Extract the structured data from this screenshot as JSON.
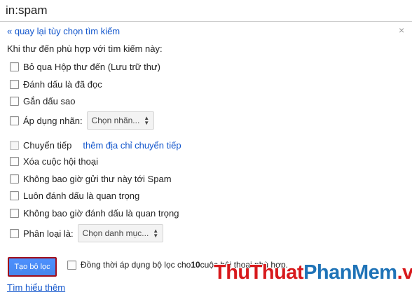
{
  "search": {
    "query": "in:spam"
  },
  "panel": {
    "back_link": "« quay lại tùy chọn tìm kiếm",
    "close": "×",
    "intro": "Khi thư đến phù hợp với tìm kiếm này:"
  },
  "options": {
    "skip_inbox": "Bỏ qua Hộp thư đến (Lưu trữ thư)",
    "mark_read": "Đánh dấu là đã đọc",
    "star": "Gắn dấu sao",
    "apply_label": "Áp dụng nhãn:",
    "label_select": "Chọn nhãn...",
    "forward": "Chuyển tiếp",
    "forward_link": "thêm địa chỉ chuyển tiếp",
    "delete": "Xóa cuộc hội thoại",
    "never_spam": "Không bao giờ gửi thư này tới Spam",
    "always_important": "Luôn đánh dấu là quan trọng",
    "never_important": "Không bao giờ đánh dấu là quan trọng",
    "categorize": "Phân loại là:",
    "category_select": "Chọn danh mục..."
  },
  "footer": {
    "create_button": "Tạo bộ lọc",
    "also_apply_prefix": "Đồng thời áp dụng bộ lọc cho ",
    "also_apply_count": "10",
    "also_apply_suffix": " cuộc hội thoại phù hợp.",
    "learn_more": "Tìm hiểu thêm"
  },
  "watermark": {
    "part1": "ThuThuat",
    "part2": "PhanMem",
    "part3": ".vn"
  },
  "colors": {
    "link": "#1155cc",
    "button": "#4d90fe",
    "highlight_border": "#a10e1b"
  }
}
